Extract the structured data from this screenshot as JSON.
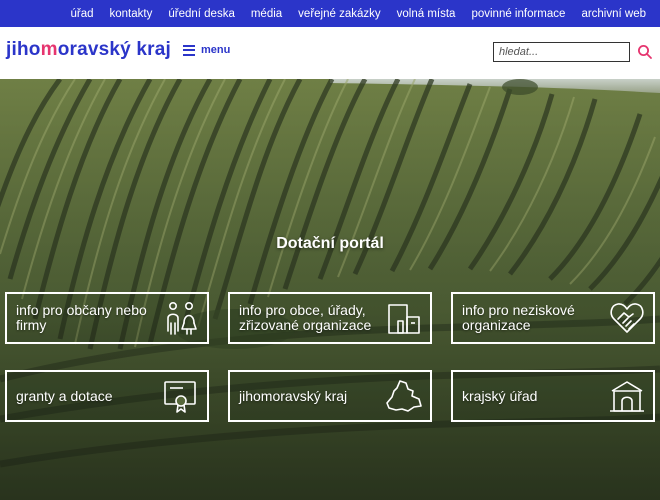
{
  "top_nav": [
    "úřad",
    "kontakty",
    "úřední deska",
    "média",
    "veřejné zakázky",
    "volná místa",
    "povinné informace",
    "archivní web"
  ],
  "logo": {
    "part1": "jiho",
    "part2": "m",
    "part3": "oravský kraj"
  },
  "menu_label": "menu",
  "search": {
    "placeholder": "hledat..."
  },
  "hero": {
    "title": "Dotační portál"
  },
  "tiles": [
    {
      "label": "info pro občany nebo firmy",
      "icon": "people-icon"
    },
    {
      "label": "info pro obce, úřady, zřizované organizace",
      "icon": "buildings-icon"
    },
    {
      "label": "info pro neziskové organizace",
      "icon": "heart-hands-icon"
    },
    {
      "label": "granty a dotace",
      "icon": "certificate-icon"
    },
    {
      "label": "jihomoravský kraj",
      "icon": "region-map-icon"
    },
    {
      "label": "krajský úřad",
      "icon": "office-building-icon"
    }
  ],
  "colors": {
    "brand": "#2b35c9",
    "accent": "#e6356f"
  }
}
